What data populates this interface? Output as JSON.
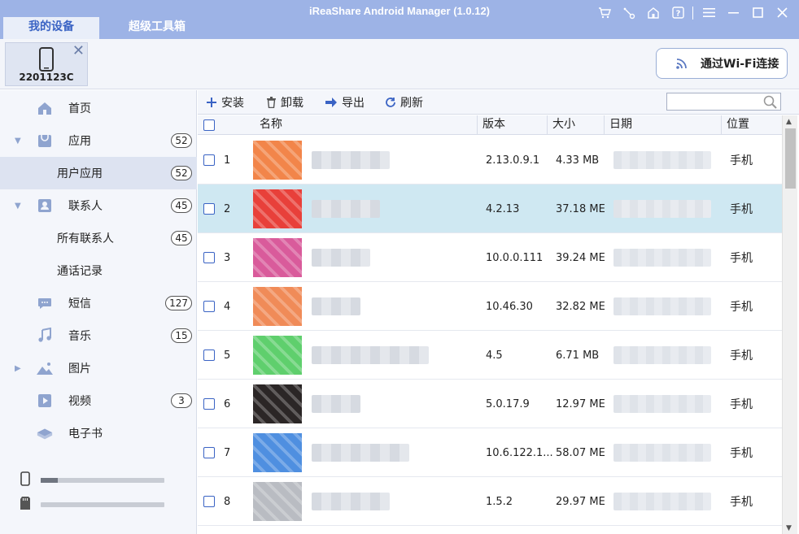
{
  "app": {
    "title": "iReaShare Android Manager (1.0.12)"
  },
  "tabs": [
    {
      "label": "我的设备",
      "active": true
    },
    {
      "label": "超级工具箱",
      "active": false
    }
  ],
  "titlebar_icons": [
    "cart-icon",
    "key-icon",
    "home-icon",
    "help-icon",
    "menu-icon",
    "minimize-icon",
    "maximize-icon",
    "close-icon"
  ],
  "device": {
    "name": "2201123C"
  },
  "wifi_button": {
    "label": "通过Wi-Fi连接"
  },
  "sidebar": {
    "items": [
      {
        "label": "首页",
        "icon": "home-icon",
        "badge": ""
      },
      {
        "label": "应用",
        "icon": "app-icon",
        "badge": "52",
        "expanded": true
      },
      {
        "label": "用户应用",
        "badge": "52",
        "sub": true,
        "selected": true
      },
      {
        "label": "联系人",
        "icon": "contacts-icon",
        "badge": "45",
        "expanded": true
      },
      {
        "label": "所有联系人",
        "badge": "45",
        "sub": true
      },
      {
        "label": "通话记录",
        "badge": "",
        "sub": true
      },
      {
        "label": "短信",
        "icon": "sms-icon",
        "badge": "127"
      },
      {
        "label": "音乐",
        "icon": "music-icon",
        "badge": "15"
      },
      {
        "label": "图片",
        "icon": "image-icon",
        "badge": "",
        "collapsed": true
      },
      {
        "label": "视频",
        "icon": "video-icon",
        "badge": "3"
      },
      {
        "label": "电子书",
        "icon": "ebook-icon",
        "badge": ""
      }
    ],
    "storage": [
      {
        "type": "phone",
        "fill": 0.14
      },
      {
        "type": "sd-card",
        "fill": 0.0
      }
    ]
  },
  "toolbar": {
    "install": "安装",
    "uninstall": "卸载",
    "export": "导出",
    "refresh": "刷新",
    "search_placeholder": ""
  },
  "table": {
    "headers": {
      "name": "名称",
      "version": "版本",
      "size": "大小",
      "date": "日期",
      "location": "位置"
    },
    "rows": [
      {
        "index": "1",
        "version": "2.13.0.9.1",
        "size": "4.33 MB",
        "location": "手机",
        "icon_color": "#f2854a",
        "selected": false
      },
      {
        "index": "2",
        "version": "4.2.13",
        "size": "37.18 ME",
        "location": "手机",
        "icon_color": "#e8403a",
        "selected": true
      },
      {
        "index": "3",
        "version": "10.0.0.111",
        "size": "39.24 ME",
        "location": "手机",
        "icon_color": "#d95b9b",
        "selected": false
      },
      {
        "index": "4",
        "version": "10.46.30",
        "size": "32.82 ME",
        "location": "手机",
        "icon_color": "#f08b58",
        "selected": false
      },
      {
        "index": "5",
        "version": "4.5",
        "size": "6.71 MB",
        "location": "手机",
        "icon_color": "#5fcf6d",
        "selected": false
      },
      {
        "index": "6",
        "version": "5.0.17.9",
        "size": "12.97 ME",
        "location": "手机",
        "icon_color": "#2b2626",
        "selected": false
      },
      {
        "index": "7",
        "version": "10.6.122.1...",
        "size": "58.07 ME",
        "location": "手机",
        "icon_color": "#4f8fe0",
        "selected": false
      },
      {
        "index": "8",
        "version": "1.5.2",
        "size": "29.97 ME",
        "location": "手机",
        "icon_color": "#b9bcc2",
        "selected": false
      }
    ]
  },
  "colors": {
    "titlebar": "#9db3e6",
    "accent": "#3a63c4",
    "selected_row": "#cfe8f2",
    "sidebar_bg": "#f4f6fb"
  }
}
